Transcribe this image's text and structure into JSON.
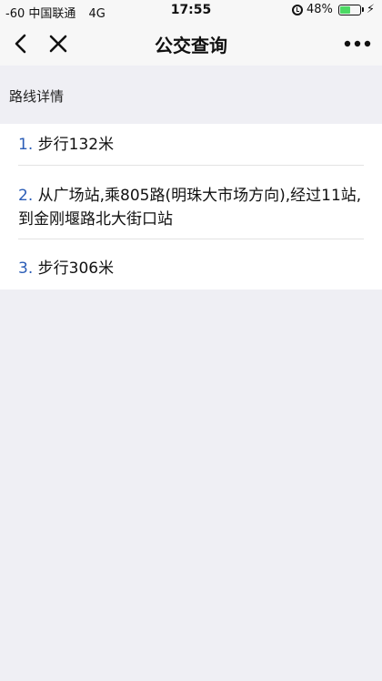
{
  "status_bar": {
    "signal": "-60",
    "carrier": "中国联通",
    "network": "4G",
    "time": "17:55",
    "battery_percent": "48%",
    "battery_level": 0.48,
    "battery_color": "#4cd964"
  },
  "nav": {
    "title": "公交查询",
    "back_icon": "chevron-left-icon",
    "close_icon": "close-icon",
    "more_icon": "more-dots-icon"
  },
  "section": {
    "title": "路线详情"
  },
  "steps": [
    {
      "num": "1.",
      "text": "步行132米"
    },
    {
      "num": "2.",
      "text": "从广场站,乘805路(明珠大市场方向),经过11站,到金刚堰路北大街口站"
    },
    {
      "num": "3.",
      "text": "步行306米"
    }
  ],
  "colors": {
    "accent": "#2b5db7",
    "background": "#efeff4",
    "card": "#ffffff"
  }
}
